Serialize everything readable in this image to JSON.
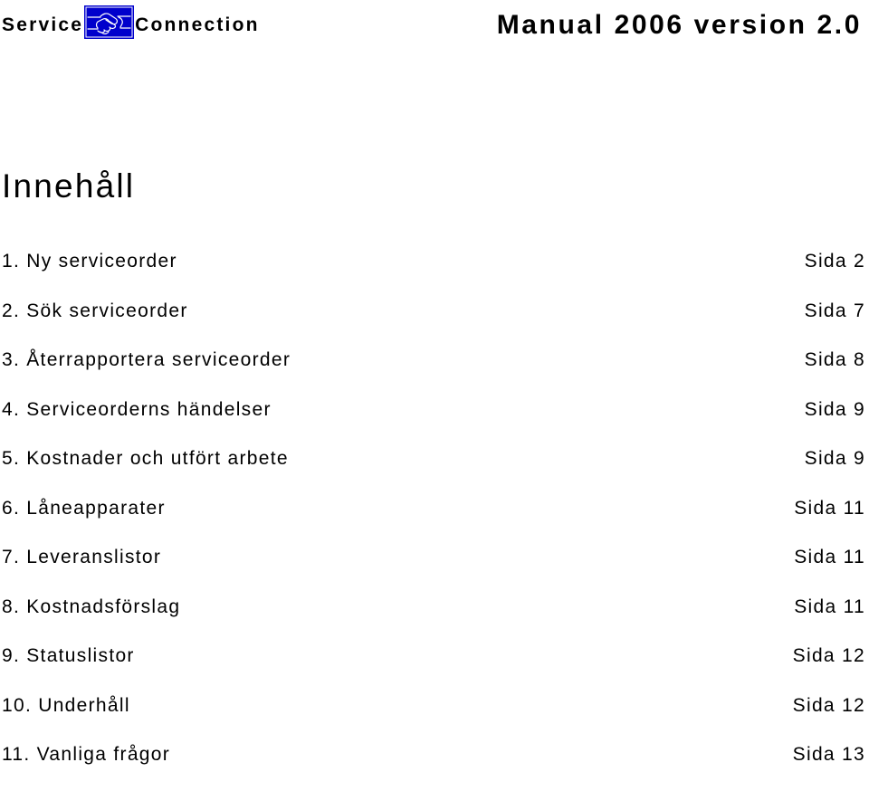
{
  "header": {
    "brand_left": "Service",
    "brand_right": "Connection",
    "logo_icon": "handshake-icon",
    "logo_bg_color": "#0000CC",
    "logo_line_color": "#FFFFFF",
    "document_title": "Manual 2006 version 2.0"
  },
  "content": {
    "heading": "Innehåll",
    "toc": [
      {
        "number": "1.",
        "label": "Ny serviceorder",
        "entry": "1. Ny serviceorder",
        "page": "Sida 2"
      },
      {
        "number": "2.",
        "label": "Sök serviceorder",
        "entry": "2. Sök serviceorder",
        "page": "Sida 7"
      },
      {
        "number": "3.",
        "label": "Återrapportera serviceorder",
        "entry": "3. Återrapportera serviceorder",
        "page": "Sida 8"
      },
      {
        "number": "4.",
        "label": "Serviceorderns händelser",
        "entry": "4. Serviceorderns händelser",
        "page": "Sida 9"
      },
      {
        "number": "5.",
        "label": "Kostnader och utfört arbete",
        "entry": "5. Kostnader och utfört arbete",
        "page": "Sida 9"
      },
      {
        "number": "6.",
        "label": "Låneapparater",
        "entry": "6. Låneapparater",
        "page": "Sida 11"
      },
      {
        "number": "7.",
        "label": "Leveranslistor",
        "entry": "7. Leveranslistor",
        "page": "Sida 11"
      },
      {
        "number": "8.",
        "label": "Kostnadsförslag",
        "entry": "8. Kostnadsförslag",
        "page": "Sida 11"
      },
      {
        "number": "9.",
        "label": "Statuslistor",
        "entry": "9. Statuslistor",
        "page": "Sida 12"
      },
      {
        "number": "10.",
        "label": "Underhåll",
        "entry": "10. Underhåll",
        "page": "Sida 12"
      },
      {
        "number": "11.",
        "label": "Vanliga frågor",
        "entry": "11. Vanliga frågor",
        "page": "Sida 13"
      }
    ]
  }
}
